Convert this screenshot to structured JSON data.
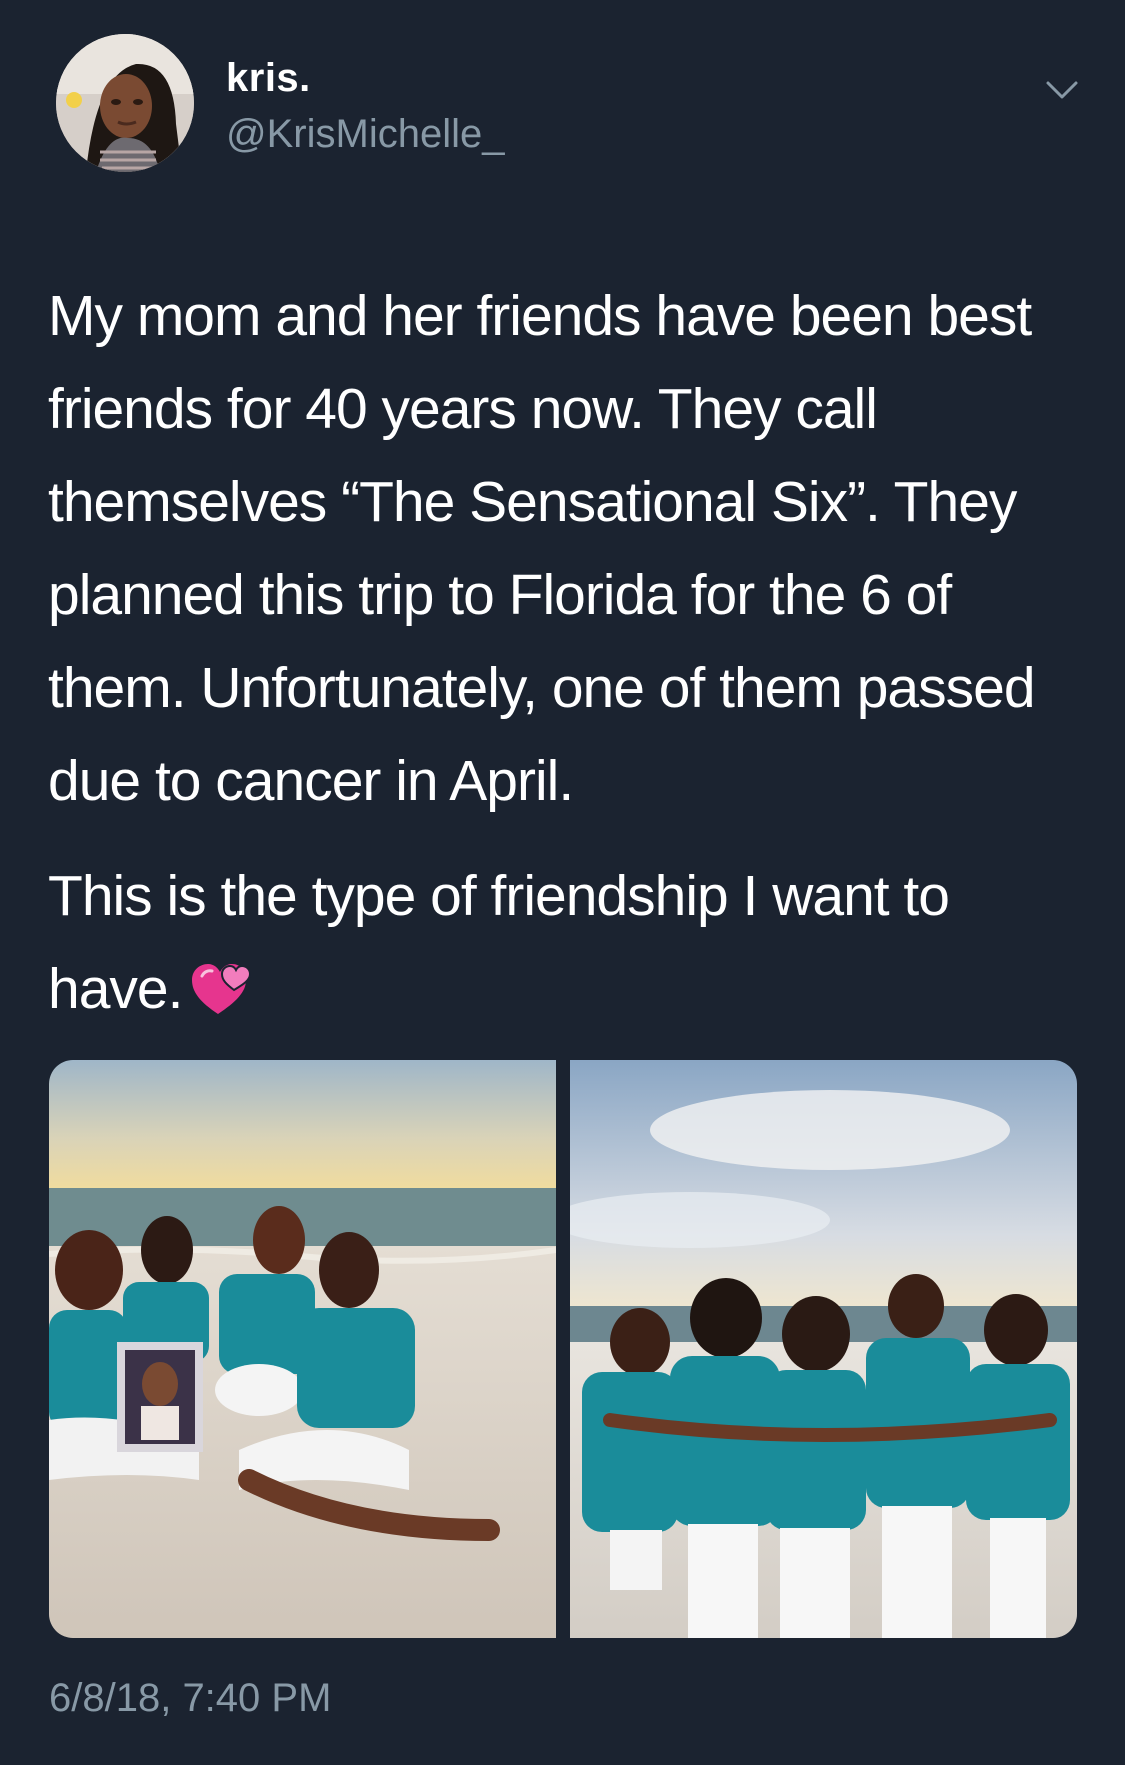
{
  "tweet": {
    "author": {
      "name": "kris.",
      "handle": "@KrisMichelle_"
    },
    "text_paragraph_1": "My mom and her friends have been best friends for 40 years now. They call themselves “The Sensational Six”. They planned this trip to Florida for the 6 of them. Unfortunately, one of them passed due to cancer in April.",
    "text_paragraph_2": "This is the type of friendship I want to have.",
    "emoji": "two-hearts-emoji",
    "media": [
      {
        "description_icon": "beach-photo-group-sitting"
      },
      {
        "description_icon": "beach-photo-group-back"
      }
    ],
    "timestamp": "6/8/18, 7:40 PM"
  },
  "colors": {
    "background": "#1b2330",
    "text": "#ffffff",
    "secondary_text": "#8899a6",
    "teal_shirts": "#1a8c9a"
  }
}
